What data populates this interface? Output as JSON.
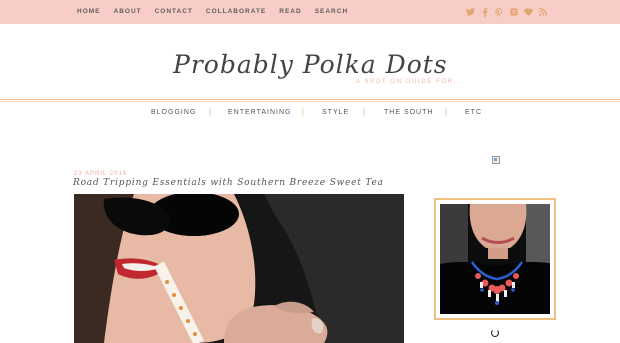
{
  "top_nav": {
    "items": [
      "HOME",
      "ABOUT",
      "CONTACT",
      "COLLABORATE",
      "READ",
      "SEARCH"
    ]
  },
  "social": {
    "icons": [
      "twitter-icon",
      "facebook-icon",
      "pinterest-icon",
      "instagram-icon",
      "bloglovin-heart-icon",
      "rss-icon"
    ],
    "color": "#e2a56e"
  },
  "header": {
    "logo": "Probably Polka Dots",
    "tagline": "A SPOT ON GUIDE FOR..."
  },
  "main_nav": {
    "items": [
      "BLOGGING",
      "ENTERTAINING",
      "STYLE",
      "THE SOUTH",
      "ETC"
    ],
    "separator": "|"
  },
  "post": {
    "date": "23 APRIL 2015",
    "title": "Road Tripping Essentials with Southern Breeze Sweet Tea"
  },
  "colors": {
    "topbar": "#f9cdc7",
    "accent": "#f0c48f",
    "date_pink": "#f0a99c"
  }
}
